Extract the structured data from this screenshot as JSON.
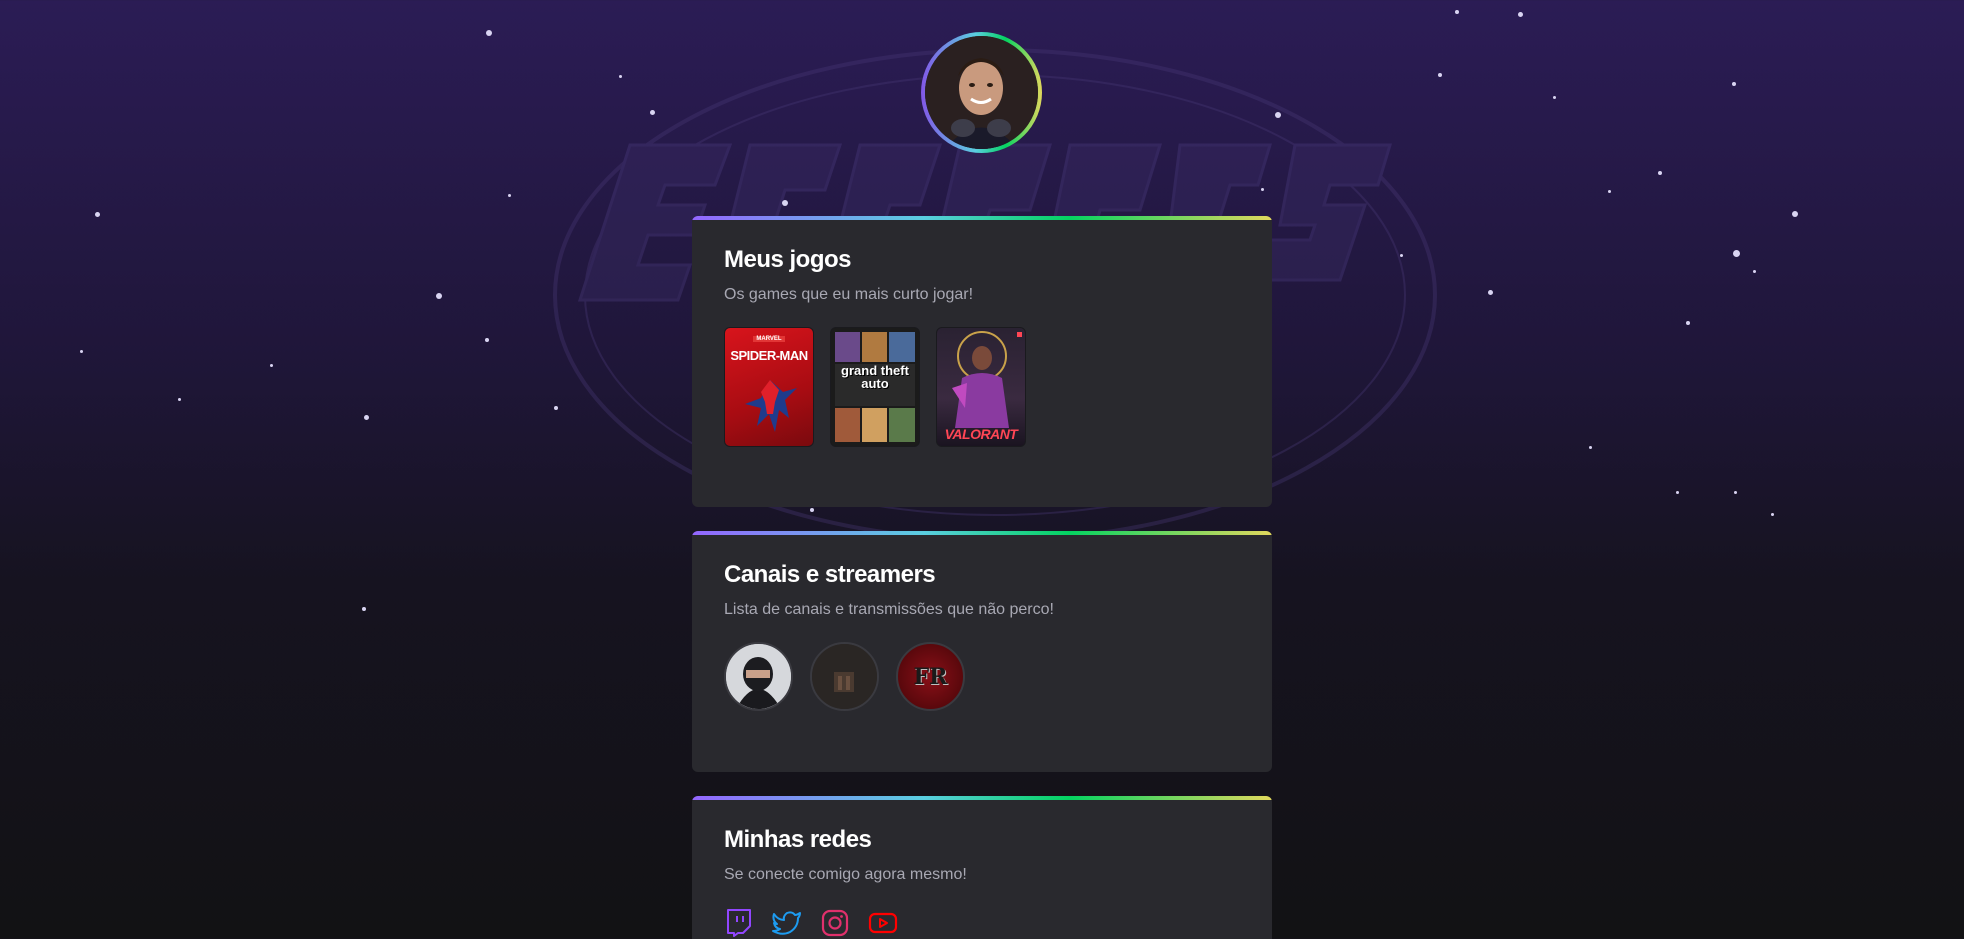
{
  "profile": {
    "avatar_alt": "Foto de perfil"
  },
  "games_card": {
    "title": "Meus jogos",
    "subtitle": "Os games que eu mais curto jogar!",
    "games": [
      {
        "name": "Marvel's Spider-Man",
        "cover_text": "SPIDER-MAN",
        "publisher_tag": "MARVEL"
      },
      {
        "name": "Grand Theft Auto V",
        "cover_text": "grand theft auto"
      },
      {
        "name": "Valorant",
        "cover_text": "VALORANT"
      }
    ]
  },
  "channels_card": {
    "title": "Canais e streamers",
    "subtitle": "Lista de canais e transmissões que não perco!",
    "channels": [
      {
        "avatar": "masked-person"
      },
      {
        "avatar": "dark-scene"
      },
      {
        "avatar": "fr-logo",
        "logo_text": "FR"
      }
    ]
  },
  "socials_card": {
    "title": "Minhas redes",
    "subtitle": "Se conecte comigo agora mesmo!",
    "links": [
      {
        "icon": "twitch-icon",
        "color": "#9146ff"
      },
      {
        "icon": "twitter-icon",
        "color": "#1d9bf0"
      },
      {
        "icon": "instagram-icon",
        "color": "#e1306c"
      },
      {
        "icon": "youtube-icon",
        "color": "#ff0000"
      }
    ]
  },
  "colors": {
    "card_bg": "#29292e",
    "accent_gradient": [
      "#9466ff",
      "#5acee0",
      "#04d361",
      "#e1d85d"
    ],
    "text_primary": "#ffffff",
    "text_secondary": "#a8a8b3"
  }
}
